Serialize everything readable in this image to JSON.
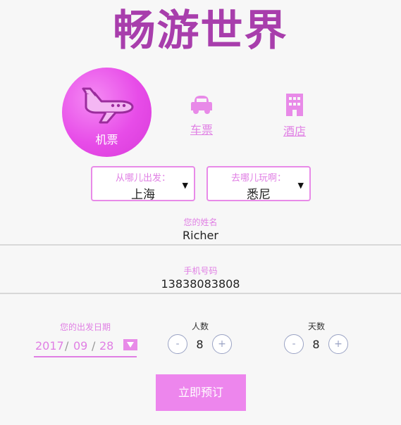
{
  "app": {
    "title": "畅游世界"
  },
  "categories": [
    {
      "label": "机票",
      "icon": "airplane-icon",
      "active": true
    },
    {
      "label": "车票",
      "icon": "car-icon",
      "active": false
    },
    {
      "label": "酒店",
      "icon": "hotel-icon",
      "active": false
    }
  ],
  "route": {
    "from": {
      "label": "从哪儿出发：",
      "value": "上海"
    },
    "to": {
      "label": "去哪儿玩啊：",
      "value": "悉尼"
    }
  },
  "form": {
    "name": {
      "label": "您的姓名",
      "value": "Richer"
    },
    "phone": {
      "label": "手机号码",
      "value": "13838083808"
    }
  },
  "date": {
    "label": "您的出发日期",
    "year": "2017",
    "month": "09",
    "day": "28",
    "sep": "/"
  },
  "people": {
    "label": "人数",
    "value": "8",
    "minus": "-",
    "plus": "+"
  },
  "days": {
    "label": "天数",
    "value": "8",
    "minus": "-",
    "plus": "+"
  },
  "submit_label": "立即预订",
  "colors": {
    "brand": "#a83eac",
    "accent": "#e07fe4",
    "button": "#ed86ed"
  }
}
